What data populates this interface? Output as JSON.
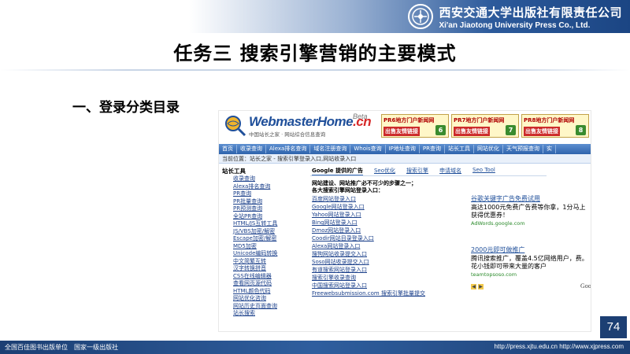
{
  "publisher": {
    "name_cn": "西安交通大学出版社有限责任公司",
    "name_en": "Xi'an Jiaotong University Press Co., Ltd."
  },
  "slide": {
    "title": "任务三 搜索引擎营销的主要模式",
    "subheading": "一、登录分类目录",
    "page_number": "74"
  },
  "screenshot": {
    "logo_text": "WebmasterHome",
    "logo_suffix": ".cn",
    "logo_beta": "Beta",
    "logo_tagline": "中国站长之家 · 网站综合信息查询",
    "ads": [
      {
        "line1": "PR6地方门户新闻网",
        "line2": "出售友情链接",
        "num": "6"
      },
      {
        "line1": "PR7地方门户新闻网",
        "line2": "出售友情链接",
        "num": "7"
      },
      {
        "line1": "PR8地方门户新闻网",
        "line2": "出售友情链接",
        "num": "8"
      }
    ],
    "nav": [
      "首页",
      "收录查询",
      "Alexa排名查询",
      "域名注册查询",
      "Whois查询",
      "IP地址查询",
      "PR查询",
      "站长工具",
      "网站优化",
      "天气预报查询",
      "实"
    ],
    "breadcrumb": "当前位置：站长之家 - 搜索引擎登录入口,网站收录入口",
    "sidebar_title": "站长工具",
    "sidebar_items": [
      "收录查询",
      "Alexa排名查询",
      "PR查询",
      "PR批量查询",
      "PR预测查询",
      "全站PR查询",
      "HTML/JS互转工具",
      "JS/VBS加密/解密",
      "Escape加密/解密",
      "MD5加密",
      "Unicode编码转换",
      "中文简繁互转",
      "汉字转换拼音",
      "CSS在线编辑器",
      "查看网页源代码",
      "HTML颜色代码",
      "网站优化咨询",
      "网站历史页面查询",
      "站长搜索"
    ],
    "tabs": [
      "Google 提供的广告",
      "Seo优化",
      "搜索引擎",
      "申请域名",
      "Seo Tool"
    ],
    "intro_line1": "网站建设、网站推广必不可少的步骤之一；",
    "intro_line2": "各大搜索引擎网站登录入口：",
    "links": [
      "百度网站登录入口",
      "Google网站登录入口",
      "Yahoo网站登录入口",
      "Bing网站登录入口",
      "Dmoz网站登录入口",
      "Coodir网站目录登录入口",
      "Alexa网站登录入口",
      "搜狗网站收录提交入口",
      "Soso网站收录提交入口",
      "有道搜索网站登录入口",
      "搜索引擎收录查询",
      "中国搜索网站登录入口",
      "Freewebsubmission.com 搜索引擎批量提交"
    ],
    "right_ads": [
      {
        "title": "谷歌关键字广告免费试用",
        "body": "高达1000元免费广告费等你拿，1分马上获得优惠券！",
        "url": "AdWords.google.com"
      },
      {
        "title": "2000元即可做推广",
        "body": "腾讯搜索推广，覆盖4.5亿网络用户，费。花小钱即可带来大量的客户",
        "url": "teamtopsoso.com"
      }
    ],
    "google_text": "Goo"
  },
  "footer": {
    "left": "全国百佳图书出版单位　国家一级出版社",
    "right": "http://press.xjtu.edu.cn  http://www.xjpress.com"
  },
  "colors": {
    "banner_dark": "#1b4583",
    "page_num_bg": "#1c3f73",
    "link_blue": "#1a3f8a",
    "nav_blue": "#2e63ac"
  }
}
